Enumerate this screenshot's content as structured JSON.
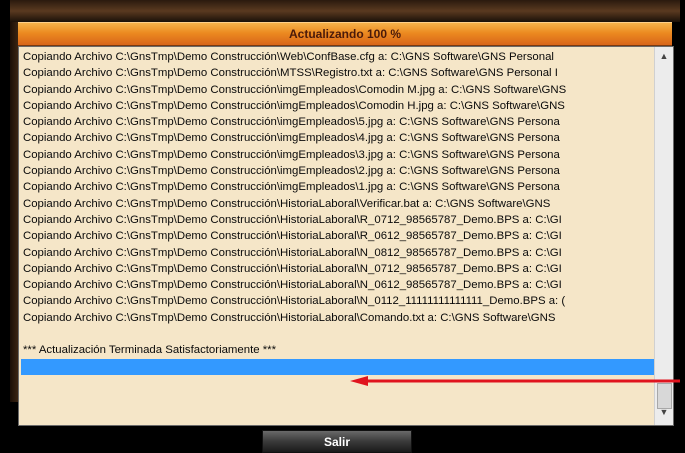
{
  "window": {
    "title": "Actualizando 100 %"
  },
  "log": {
    "lines": [
      "Copiando Archivo C:\\GnsTmp\\Demo Construcción\\Web\\ConfBase.cfg a: C:\\GNS Software\\GNS Personal",
      "Copiando Archivo C:\\GnsTmp\\Demo Construcción\\MTSS\\Registro.txt a: C:\\GNS Software\\GNS Personal I",
      "Copiando Archivo C:\\GnsTmp\\Demo Construcción\\imgEmpleados\\Comodin M.jpg a: C:\\GNS Software\\GNS",
      "Copiando Archivo C:\\GnsTmp\\Demo Construcción\\imgEmpleados\\Comodin H.jpg a: C:\\GNS Software\\GNS",
      "Copiando Archivo C:\\GnsTmp\\Demo Construcción\\imgEmpleados\\5.jpg a: C:\\GNS Software\\GNS Persona",
      "Copiando Archivo C:\\GnsTmp\\Demo Construcción\\imgEmpleados\\4.jpg a: C:\\GNS Software\\GNS Persona",
      "Copiando Archivo C:\\GnsTmp\\Demo Construcción\\imgEmpleados\\3.jpg a: C:\\GNS Software\\GNS Persona",
      "Copiando Archivo C:\\GnsTmp\\Demo Construcción\\imgEmpleados\\2.jpg a: C:\\GNS Software\\GNS Persona",
      "Copiando Archivo C:\\GnsTmp\\Demo Construcción\\imgEmpleados\\1.jpg a: C:\\GNS Software\\GNS Persona",
      "Copiando Archivo C:\\GnsTmp\\Demo Construcción\\HistoriaLaboral\\Verificar.bat a: C:\\GNS Software\\GNS",
      "Copiando Archivo C:\\GnsTmp\\Demo Construcción\\HistoriaLaboral\\R_0712_98565787_Demo.BPS a: C:\\GI",
      "Copiando Archivo C:\\GnsTmp\\Demo Construcción\\HistoriaLaboral\\R_0612_98565787_Demo.BPS a: C:\\GI",
      "Copiando Archivo C:\\GnsTmp\\Demo Construcción\\HistoriaLaboral\\N_0812_98565787_Demo.BPS a: C:\\GI",
      "Copiando Archivo C:\\GnsTmp\\Demo Construcción\\HistoriaLaboral\\N_0712_98565787_Demo.BPS a: C:\\GI",
      "Copiando Archivo C:\\GnsTmp\\Demo Construcción\\HistoriaLaboral\\N_0612_98565787_Demo.BPS a: C:\\GI",
      "Copiando Archivo C:\\GnsTmp\\Demo Construcción\\HistoriaLaboral\\N_0112_11111111111111_Demo.BPS a: (",
      "Copiando Archivo C:\\GnsTmp\\Demo Construcción\\HistoriaLaboral\\Comando.txt a: C:\\GNS Software\\GNS"
    ],
    "success_message": "*** Actualización Terminada Satisfactoriamente ***"
  },
  "footer": {
    "salir_label": "Salir"
  },
  "colors": {
    "title_bar": "#ec8a20",
    "log_background": "#f5e6c8",
    "selection": "#3399ff",
    "arrow": "#e0141e"
  }
}
